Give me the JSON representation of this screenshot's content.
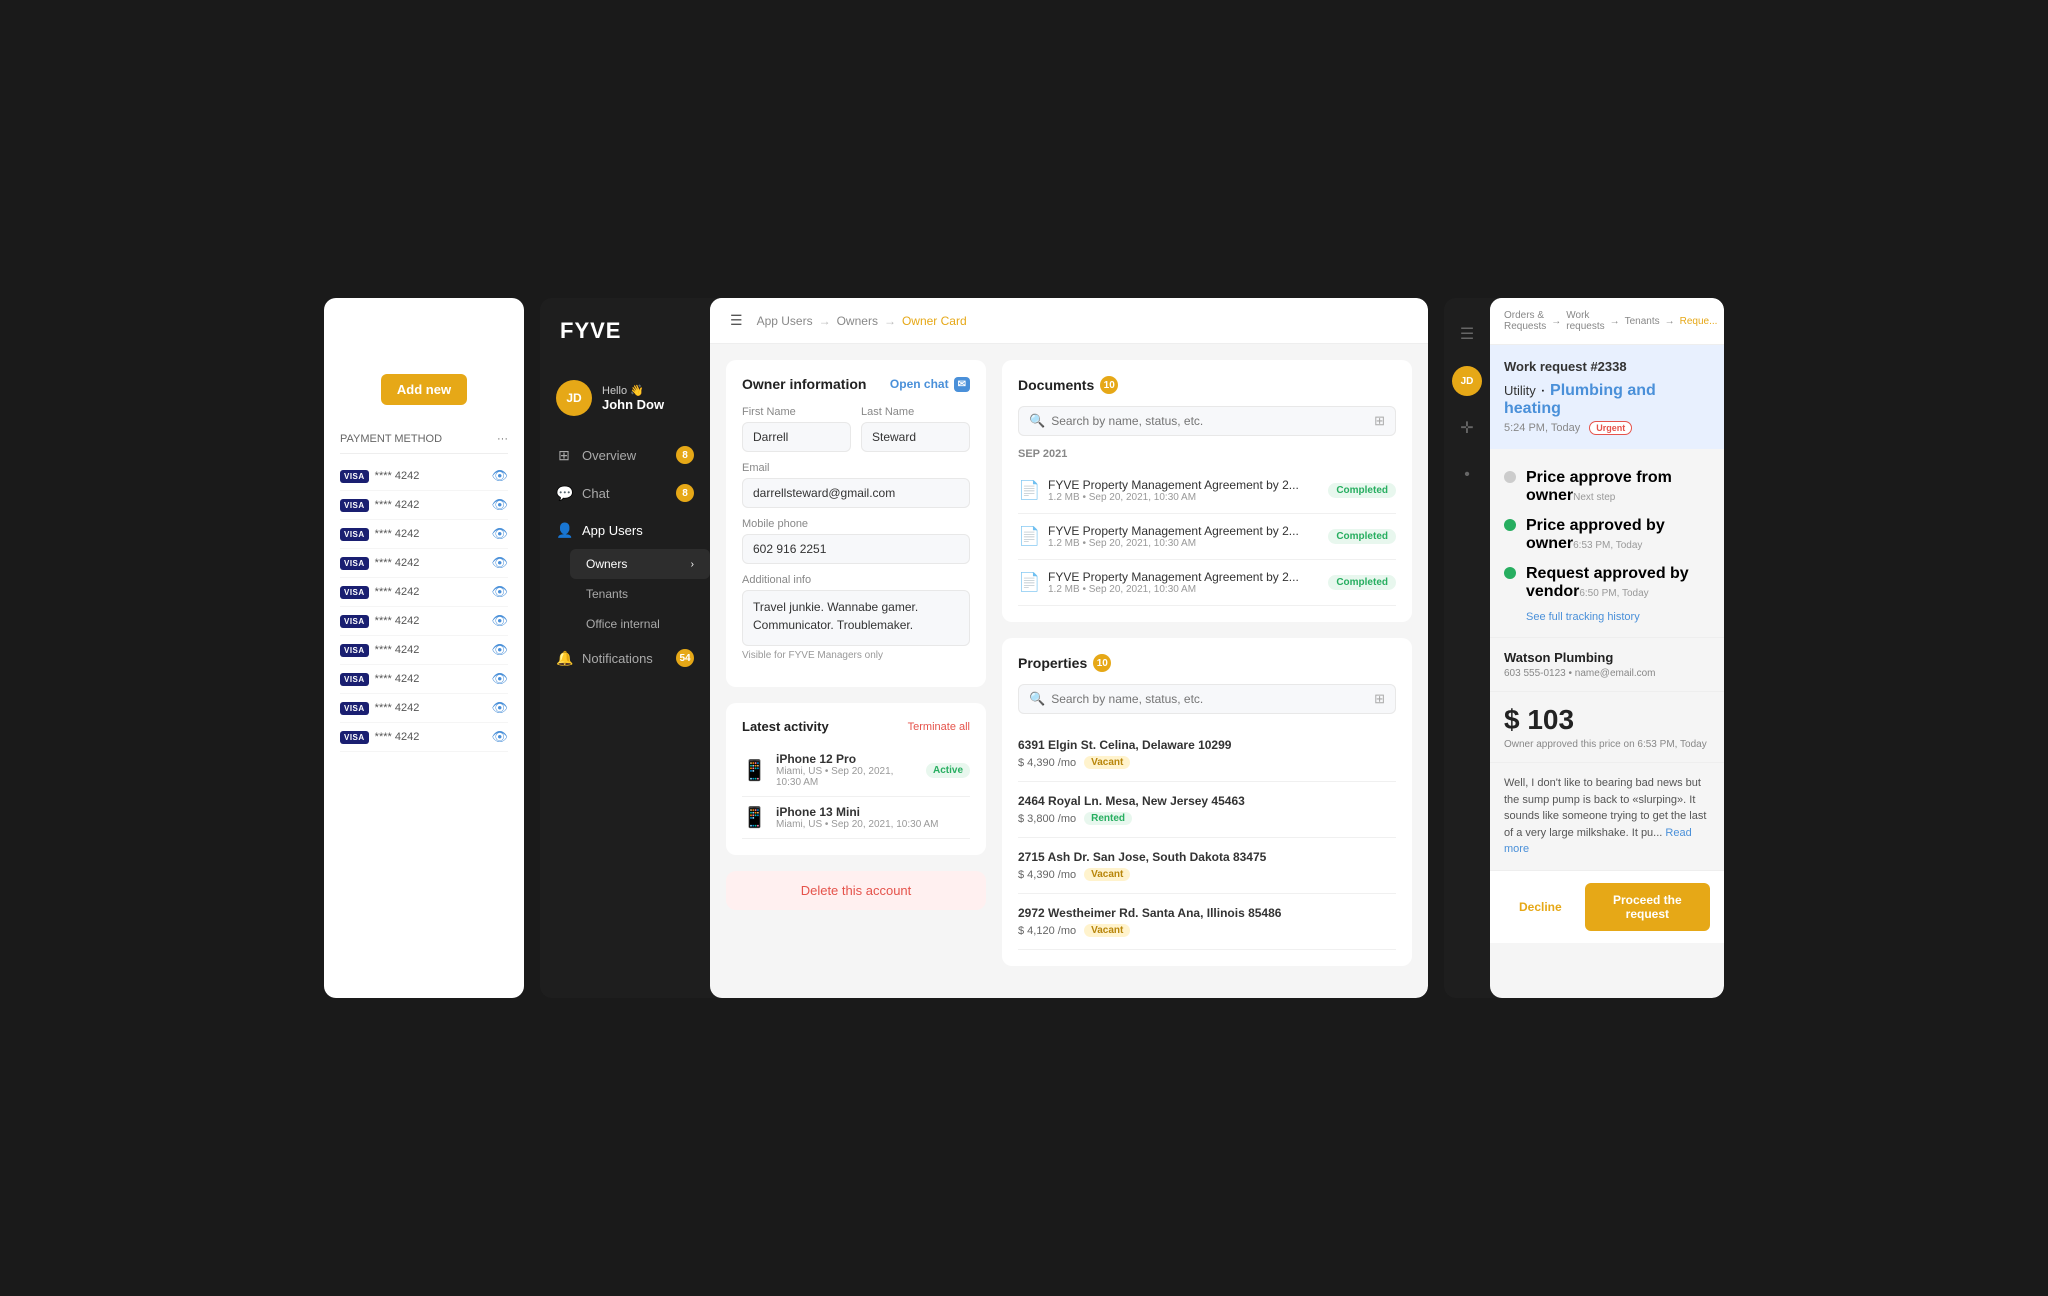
{
  "app": {
    "title": "FYVE"
  },
  "left_panel": {
    "add_new_label": "Add new",
    "payment_header": "PAYMENT METHOD",
    "payment_rows": [
      {
        "card": "**** 4242"
      },
      {
        "card": "**** 4242"
      },
      {
        "card": "**** 4242"
      },
      {
        "card": "**** 4242"
      },
      {
        "card": "**** 4242"
      },
      {
        "card": "**** 4242"
      },
      {
        "card": "**** 4242"
      },
      {
        "card": "**** 4242"
      },
      {
        "card": "**** 4242"
      },
      {
        "card": "**** 4242"
      }
    ]
  },
  "sidebar": {
    "logo": "FYVE",
    "user": {
      "initials": "JD",
      "greeting": "Hello 👋",
      "name": "John Dow"
    },
    "nav": [
      {
        "label": "Overview",
        "icon": "⊞",
        "badge": "8",
        "active": false
      },
      {
        "label": "Chat",
        "icon": "💬",
        "badge": "8",
        "active": false
      },
      {
        "label": "App Users",
        "icon": "👤",
        "badge": null,
        "active": true
      },
      {
        "label": "Notifications",
        "icon": "🔔",
        "badge": "54",
        "active": false
      }
    ],
    "sub_nav": [
      {
        "label": "Owners",
        "active": true
      },
      {
        "label": "Tenants",
        "active": false
      },
      {
        "label": "Office internal",
        "active": false
      }
    ]
  },
  "breadcrumb": {
    "items": [
      "App Users",
      "Owners",
      "Owner Card"
    ],
    "active_index": 2
  },
  "owner_info": {
    "title": "Owner information",
    "open_chat_label": "Open chat",
    "first_name_label": "First Name",
    "first_name": "Darrell",
    "last_name_label": "Last Name",
    "last_name": "Steward",
    "email_label": "Email",
    "email": "darrellsteward@gmail.com",
    "phone_label": "Mobile phone",
    "phone": "602 916 2251",
    "additional_label": "Additional info",
    "additional": "Travel junkie. Wannabe gamer. Communicator. Troublemaker.",
    "visible_note": "Visible for FYVE Managers only"
  },
  "latest_activity": {
    "title": "Latest activity",
    "terminate_label": "Terminate all",
    "devices": [
      {
        "name": "iPhone 12 Pro",
        "meta": "Miami, US • Sep 20, 2021, 10:30 AM",
        "status": "Active"
      },
      {
        "name": "iPhone 13 Mini",
        "meta": "Miami, US • Sep 20, 2021, 10:30 AM",
        "status": null
      }
    ]
  },
  "delete_label": "Delete this account",
  "documents": {
    "title": "Documents",
    "count": "10",
    "search_placeholder": "Search by name, status, etc.",
    "section_label": "SEP 2021",
    "items": [
      {
        "name": "FYVE Property Management Agreement by 2...",
        "meta": "1.2 MB • Sep 20, 2021, 10:30 AM",
        "status": "Completed"
      },
      {
        "name": "FYVE Property Management Agreement by 2...",
        "meta": "1.2 MB • Sep 20, 2021, 10:30 AM",
        "status": "Completed"
      },
      {
        "name": "FYVE Property Management Agreement by 2...",
        "meta": "1.2 MB • Sep 20, 2021, 10:30 AM",
        "status": "Completed"
      }
    ]
  },
  "properties": {
    "title": "Properties",
    "count": "10",
    "search_placeholder": "Search by name, status, etc.",
    "items": [
      {
        "address": "6391 Elgin St. Celina, Delaware 10299",
        "price": "$ 4,390 /mo",
        "status": "Vacant"
      },
      {
        "address": "2464 Royal Ln. Mesa, New Jersey 45463",
        "price": "$ 3,800 /mo",
        "status": "Rented"
      },
      {
        "address": "2715 Ash Dr. San Jose, South Dakota 83475",
        "price": "$ 4,390 /mo",
        "status": "Vacant"
      },
      {
        "address": "2972 Westheimer Rd. Santa Ana, Illinois 85486",
        "price": "$ 4,120 /mo",
        "status": "Vacant"
      }
    ]
  },
  "right_panel": {
    "breadcrumb": [
      "Orders & Requests",
      "Work requests",
      "Tenants",
      "Reque..."
    ],
    "work_request": {
      "id": "Work request #2338",
      "utility_label": "Utility",
      "utility_type": "Plumbing and heating",
      "time": "5:24 PM, Today",
      "urgency": "Urgent"
    },
    "tracking": [
      {
        "label": "Price approve from owner",
        "sub": "Next step",
        "done": false
      },
      {
        "label": "Price approved by owner",
        "sub": "6:53 PM, Today",
        "done": true
      },
      {
        "label": "Request approved by vendor",
        "sub": "6:50 PM, Today",
        "done": true
      }
    ],
    "see_history_label": "See full tracking history",
    "vendor": {
      "name": "Watson Plumbing",
      "contact": "603 555-0123 • name@email.com"
    },
    "price": {
      "amount": "$ 103",
      "note": "Owner approved this price on 6:53 PM, Today"
    },
    "message": "Well, I don't like to bearing bad news but the sump pump is back to «slurping». It sounds like someone trying to get the last of a very large milkshake. It pu...",
    "read_more_label": "Read more",
    "decline_label": "Decline",
    "proceed_label": "Proceed the request"
  }
}
